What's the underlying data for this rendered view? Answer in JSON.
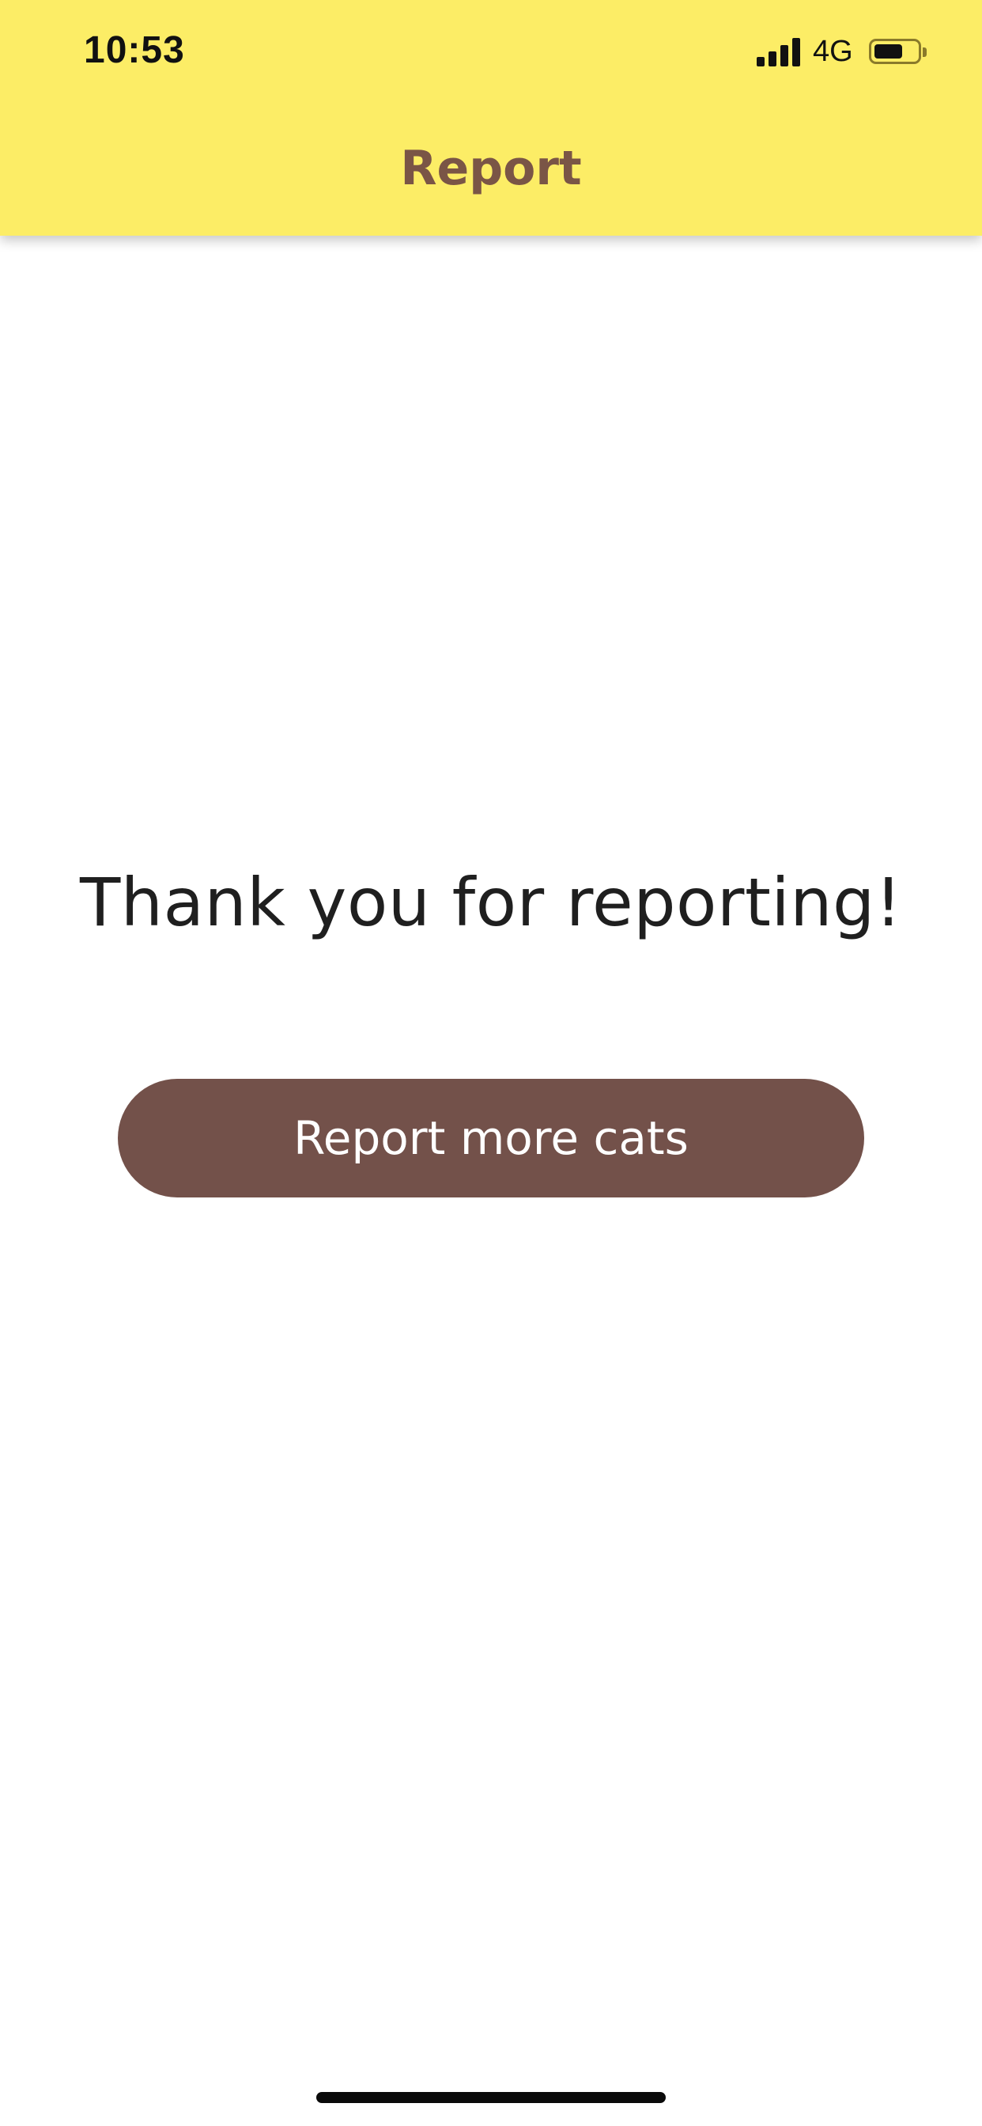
{
  "status_bar": {
    "time": "10:53",
    "network": "4G",
    "signal_icon": "cellular-signal-icon",
    "battery_icon": "battery-icon",
    "battery_level": 0.65
  },
  "header": {
    "title": "Report",
    "background_color": "#fced66",
    "title_color": "#7a5546"
  },
  "main": {
    "message": "Thank you for reporting!",
    "button_label": "Report more cats",
    "button_color": "#73514a"
  }
}
